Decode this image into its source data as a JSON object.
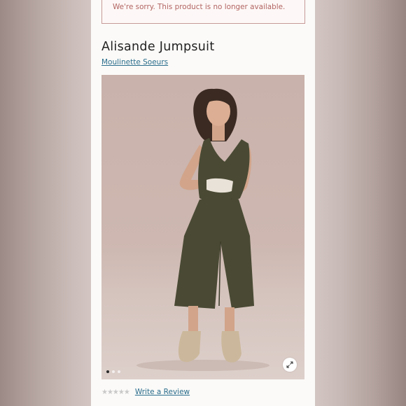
{
  "notice": {
    "text": "We're sorry. This product is no longer available."
  },
  "product": {
    "title": "Alisande Jumpsuit",
    "brand": "Moulinette Soeurs"
  },
  "gallery": {
    "dots": [
      "active",
      "",
      ""
    ],
    "expand_icon": "expand-arrows-icon"
  },
  "rating": {
    "stars": "★★★★★",
    "review_link": "Write a Review"
  },
  "colors": {
    "notice_text": "#b26462",
    "link": "#2a6d8c",
    "jumpsuit": "#4a4a34"
  }
}
